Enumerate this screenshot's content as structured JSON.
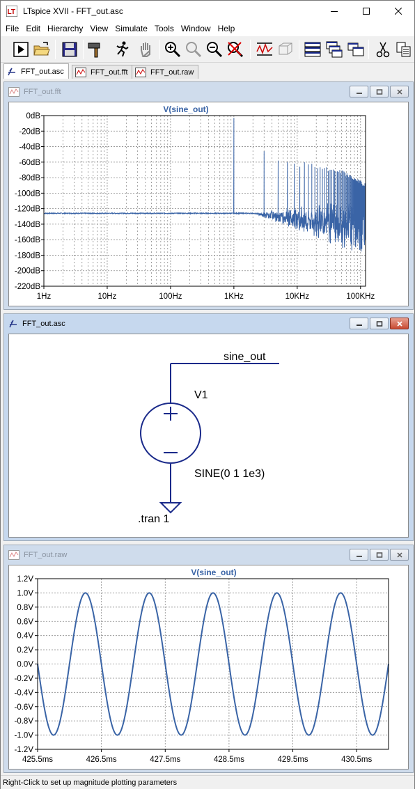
{
  "window": {
    "title": "LTspice XVII - FFT_out.asc",
    "minimize_icon": "minimize-icon",
    "maximize_icon": "maximize-icon",
    "close_icon": "close-icon"
  },
  "menu": [
    "File",
    "Edit",
    "Hierarchy",
    "View",
    "Simulate",
    "Tools",
    "Window",
    "Help"
  ],
  "toolbar": {
    "icons": [
      "run-icon",
      "open-folder-icon",
      "save-icon",
      "control-panel-hammer-icon",
      "halt-run-icon",
      "pan-hand-icon",
      "zoom-in-icon",
      "zoom-area-icon",
      "zoom-out-icon",
      "zoom-cancel-icon",
      "autorange-icon",
      "3d-view-icon",
      "tile-horizontal-icon",
      "cascade-icon",
      "tile-vertical-icon",
      "cut-icon",
      "copy-icon"
    ]
  },
  "tabs": [
    {
      "label": "FFT_out.asc",
      "icon": "schematic-icon",
      "active": true
    },
    {
      "label": "FFT_out.fft",
      "icon": "waveform-icon",
      "active": false
    },
    {
      "label": "FFT_out.raw",
      "icon": "waveform-icon",
      "active": false
    }
  ],
  "fft_window": {
    "title": "FFT_out.fft",
    "chart_data": {
      "type": "line",
      "title": "V(sine_out)",
      "x_scale": "log",
      "x_ticks": [
        "1Hz",
        "10Hz",
        "100Hz",
        "1KHz",
        "10KHz",
        "100KHz"
      ],
      "y_ticks": [
        "0dB",
        "-20dB",
        "-40dB",
        "-60dB",
        "-80dB",
        "-100dB",
        "-120dB",
        "-140dB",
        "-160dB",
        "-180dB",
        "-200dB",
        "-220dB"
      ],
      "xlim_hz": [
        1,
        120000
      ],
      "ylim_db": [
        -220,
        0
      ],
      "grid": true,
      "series": [
        {
          "noise_floor_db": -126,
          "spikes": [
            {
              "freq_hz": 1000,
              "db": -3
            },
            {
              "freq_hz": 3000,
              "db": -46
            },
            {
              "freq_hz": 5000,
              "db": -58
            },
            {
              "freq_hz": 7000,
              "db": -60
            },
            {
              "freq_hz": 9000,
              "db": -62
            },
            {
              "freq_hz": 11000,
              "db": -66
            },
            {
              "freq_hz": 13000,
              "db": -60
            },
            {
              "freq_hz": 15000,
              "db": -63
            }
          ]
        }
      ],
      "color": "#3a64a6"
    }
  },
  "schematic_window": {
    "title": "FFT_out.asc",
    "net_label": "sine_out",
    "component_name": "V1",
    "component_value": "SINE(0 1 1e3)",
    "directive": ".tran 1"
  },
  "raw_window": {
    "title": "FFT_out.raw",
    "chart_data": {
      "type": "line",
      "title": "V(sine_out)",
      "x_ticks": [
        "425.5ms",
        "426.5ms",
        "427.5ms",
        "428.5ms",
        "429.5ms",
        "430.5ms"
      ],
      "y_ticks": [
        "1.2V",
        "1.0V",
        "0.8V",
        "0.6V",
        "0.4V",
        "0.2V",
        "0.0V",
        "-0.2V",
        "-0.4V",
        "-0.6V",
        "-0.8V",
        "-1.0V",
        "-1.2V"
      ],
      "xlim_ms": [
        425.5,
        431.0
      ],
      "ylim_v": [
        -1.2,
        1.2
      ],
      "grid": true,
      "series": [
        {
          "amplitude_v": 1.0,
          "frequency_hz": 1000
        }
      ],
      "color": "#3a64a6"
    }
  },
  "status": {
    "text": "Right-Click to set up magnitude plotting parameters"
  }
}
